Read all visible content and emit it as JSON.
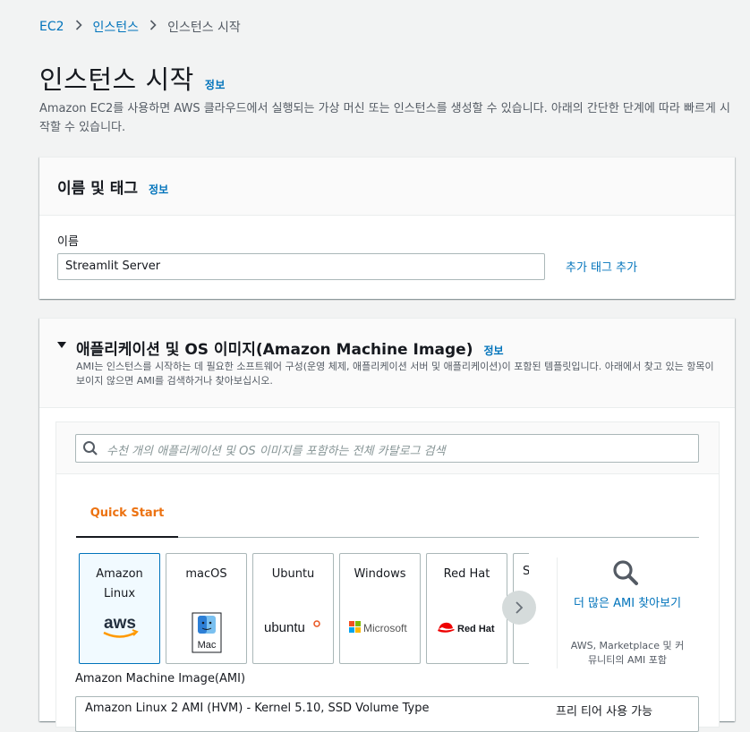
{
  "breadcrumb": {
    "items": [
      "EC2",
      "인스턴스"
    ],
    "current": "인스턴스 시작"
  },
  "page": {
    "title": "인스턴스 시작",
    "info": "정보",
    "description": "Amazon EC2를 사용하면 AWS 클라우드에서 실행되는 가상 머신 또는 인스턴스를 생성할 수 있습니다. 아래의 간단한 단계에 따라 빠르게 시작할 수 있습니다."
  },
  "name_tags": {
    "title": "이름 및 태그",
    "info": "정보",
    "name_label": "이름",
    "name_value": "Streamlit Server",
    "add_tags": "추가 태그 추가"
  },
  "ami": {
    "title": "애플리케이션 및 OS 이미지(Amazon Machine Image)",
    "info": "정보",
    "description": "AMI는 인스턴스를 시작하는 데 필요한 소프트웨어 구성(운영 체제, 애플리케이션 서버 및 애플리케이션)이 포함된 템플릿입니다. 아래에서 찾고 있는 항목이 보이지 않으면 AMI를 검색하거나 찾아보십시오.",
    "search_placeholder": "수천 개의 애플리케이션 및 OS 이미지를 포함하는 전체 카탈로그 검색",
    "tab": "Quick Start",
    "cards": [
      {
        "label": "Amazon Linux",
        "logo": "aws",
        "selected": true
      },
      {
        "label": "macOS",
        "logo": "Mac"
      },
      {
        "label": "Ubuntu",
        "logo": "ubuntu"
      },
      {
        "label": "Windows",
        "logo": "Microsoft"
      },
      {
        "label": "Red Hat",
        "logo": "Red Hat"
      },
      {
        "label": "S",
        "logo": ""
      }
    ],
    "more_link": "더 많은 AMI 찾아보기",
    "more_sub": "AWS, Marketplace 및 커뮤니티의 AMI 포함",
    "ami_label": "Amazon Machine Image(AMI)",
    "ami_value": "Amazon Linux 2 AMI (HVM) - Kernel 5.10, SSD Volume Type",
    "free_tier": "프리 티어 사용 가능",
    "colors": {
      "accent_orange": "#ec7211",
      "link_blue": "#0073bb",
      "selected_bg": "#f1faff"
    },
    "icons": [
      "search-icon",
      "chevron-right-icon",
      "caret-down-icon",
      "magnifier-icon"
    ]
  }
}
